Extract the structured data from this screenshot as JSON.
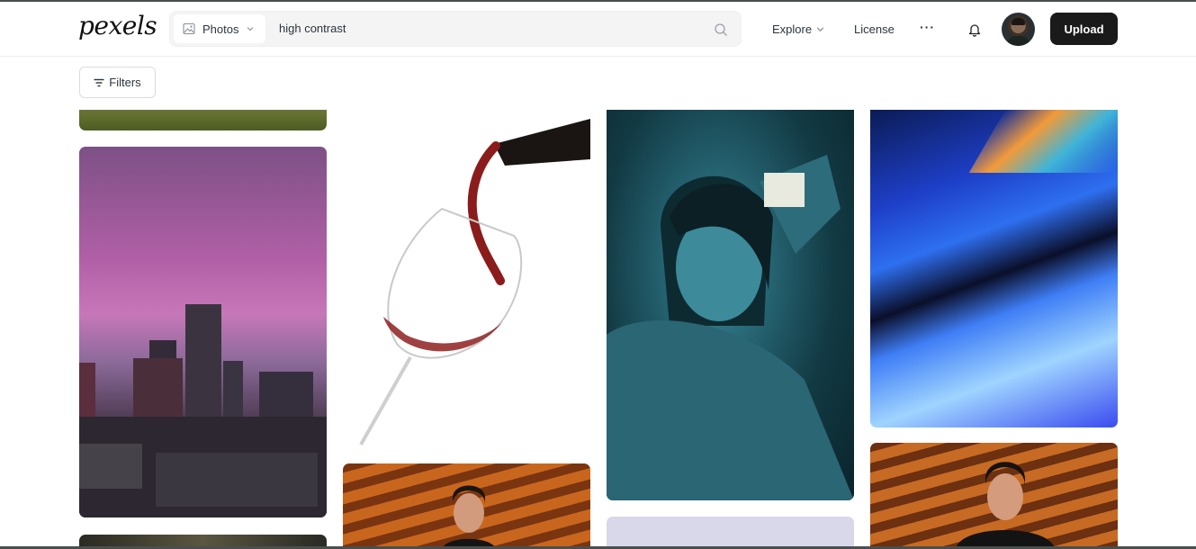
{
  "header": {
    "logo": "pexels",
    "search": {
      "media_type": "Photos",
      "query": "high contrast",
      "icons": {
        "media": "image-icon",
        "dropdown": "chevron-down-icon",
        "search": "search-icon"
      }
    },
    "nav": {
      "explore": "Explore",
      "license": "License",
      "more": "···"
    },
    "icons": {
      "notifications": "bell-icon",
      "avatar": "avatar"
    },
    "upload_label": "Upload"
  },
  "toolbar": {
    "filters_label": "Filters",
    "filters_icon": "filter-icon"
  },
  "gallery": {
    "columns": 4,
    "photos": [
      {
        "name": "photo-grass-field",
        "column": 1,
        "subject": "grass field"
      },
      {
        "name": "photo-city-sunset",
        "column": 1,
        "subject": "city skyline under purple sky"
      },
      {
        "name": "photo-dark-partial",
        "column": 1,
        "subject": "dark photo"
      },
      {
        "name": "photo-red-wine-pour",
        "column": 2,
        "subject": "red wine poured into glass"
      },
      {
        "name": "photo-woman-orange-light",
        "column": 2,
        "subject": "woman with orange striped light"
      },
      {
        "name": "photo-teal-portrait",
        "column": 3,
        "subject": "teal toned portrait of woman"
      },
      {
        "name": "photo-lavender-partial",
        "column": 3,
        "subject": "lavender photo"
      },
      {
        "name": "photo-blue-abstract",
        "column": 4,
        "subject": "blue abstract light streaks"
      },
      {
        "name": "photo-woman-orange-light-2",
        "column": 4,
        "subject": "woman with orange striped light"
      }
    ]
  },
  "colors": {
    "upload_bg": "#1a1a1a",
    "search_bg": "#f4f4f5",
    "text": "#2c343e"
  }
}
